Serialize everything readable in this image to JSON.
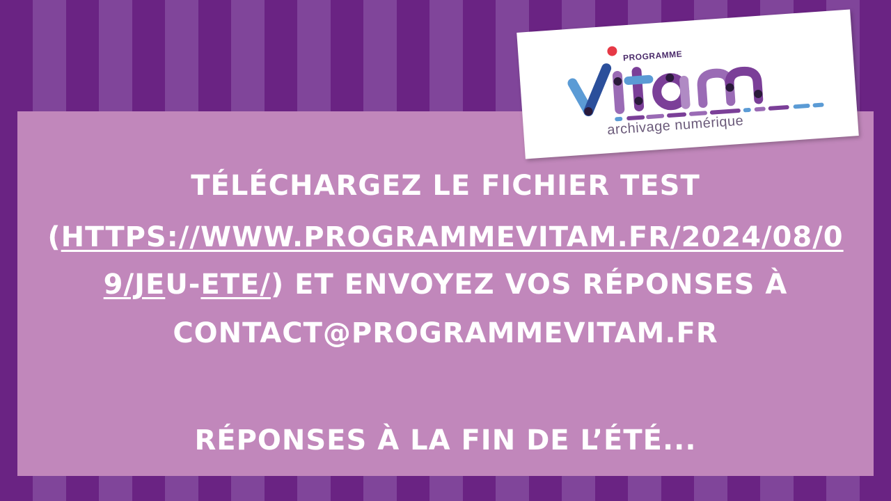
{
  "message": {
    "line1": "TÉLÉCHARGEZ LE FICHIER TEST",
    "line2_prefix": "(",
    "line2_link": "HTTPS://WWW.PROGRAMMEVITAM.FR/2024/08/0",
    "line3_link_a": "9/JE",
    "line3_plain_u": "U-",
    "line3_link_b": "ETE/",
    "line3_suffix": ") ET  ENVOYEZ VOS RÉPONSES À",
    "line4": "CONTACT@PROGRAMMEVITAM.FR",
    "line5": "RÉPONSES À LA FIN DE L’ÉTÉ..."
  },
  "logo": {
    "programme": "PROGRAMME",
    "wordmark": "vitam",
    "tagline": "archivage numérique"
  },
  "colors": {
    "stripe_dark": "#6a2383",
    "stripe_light": "#80459a",
    "panel": "#c187bb",
    "text": "#ffffff",
    "logo_red_dot": "#e63946",
    "logo_blue": "#5b9bd5",
    "logo_purple": "#7b3f98"
  }
}
